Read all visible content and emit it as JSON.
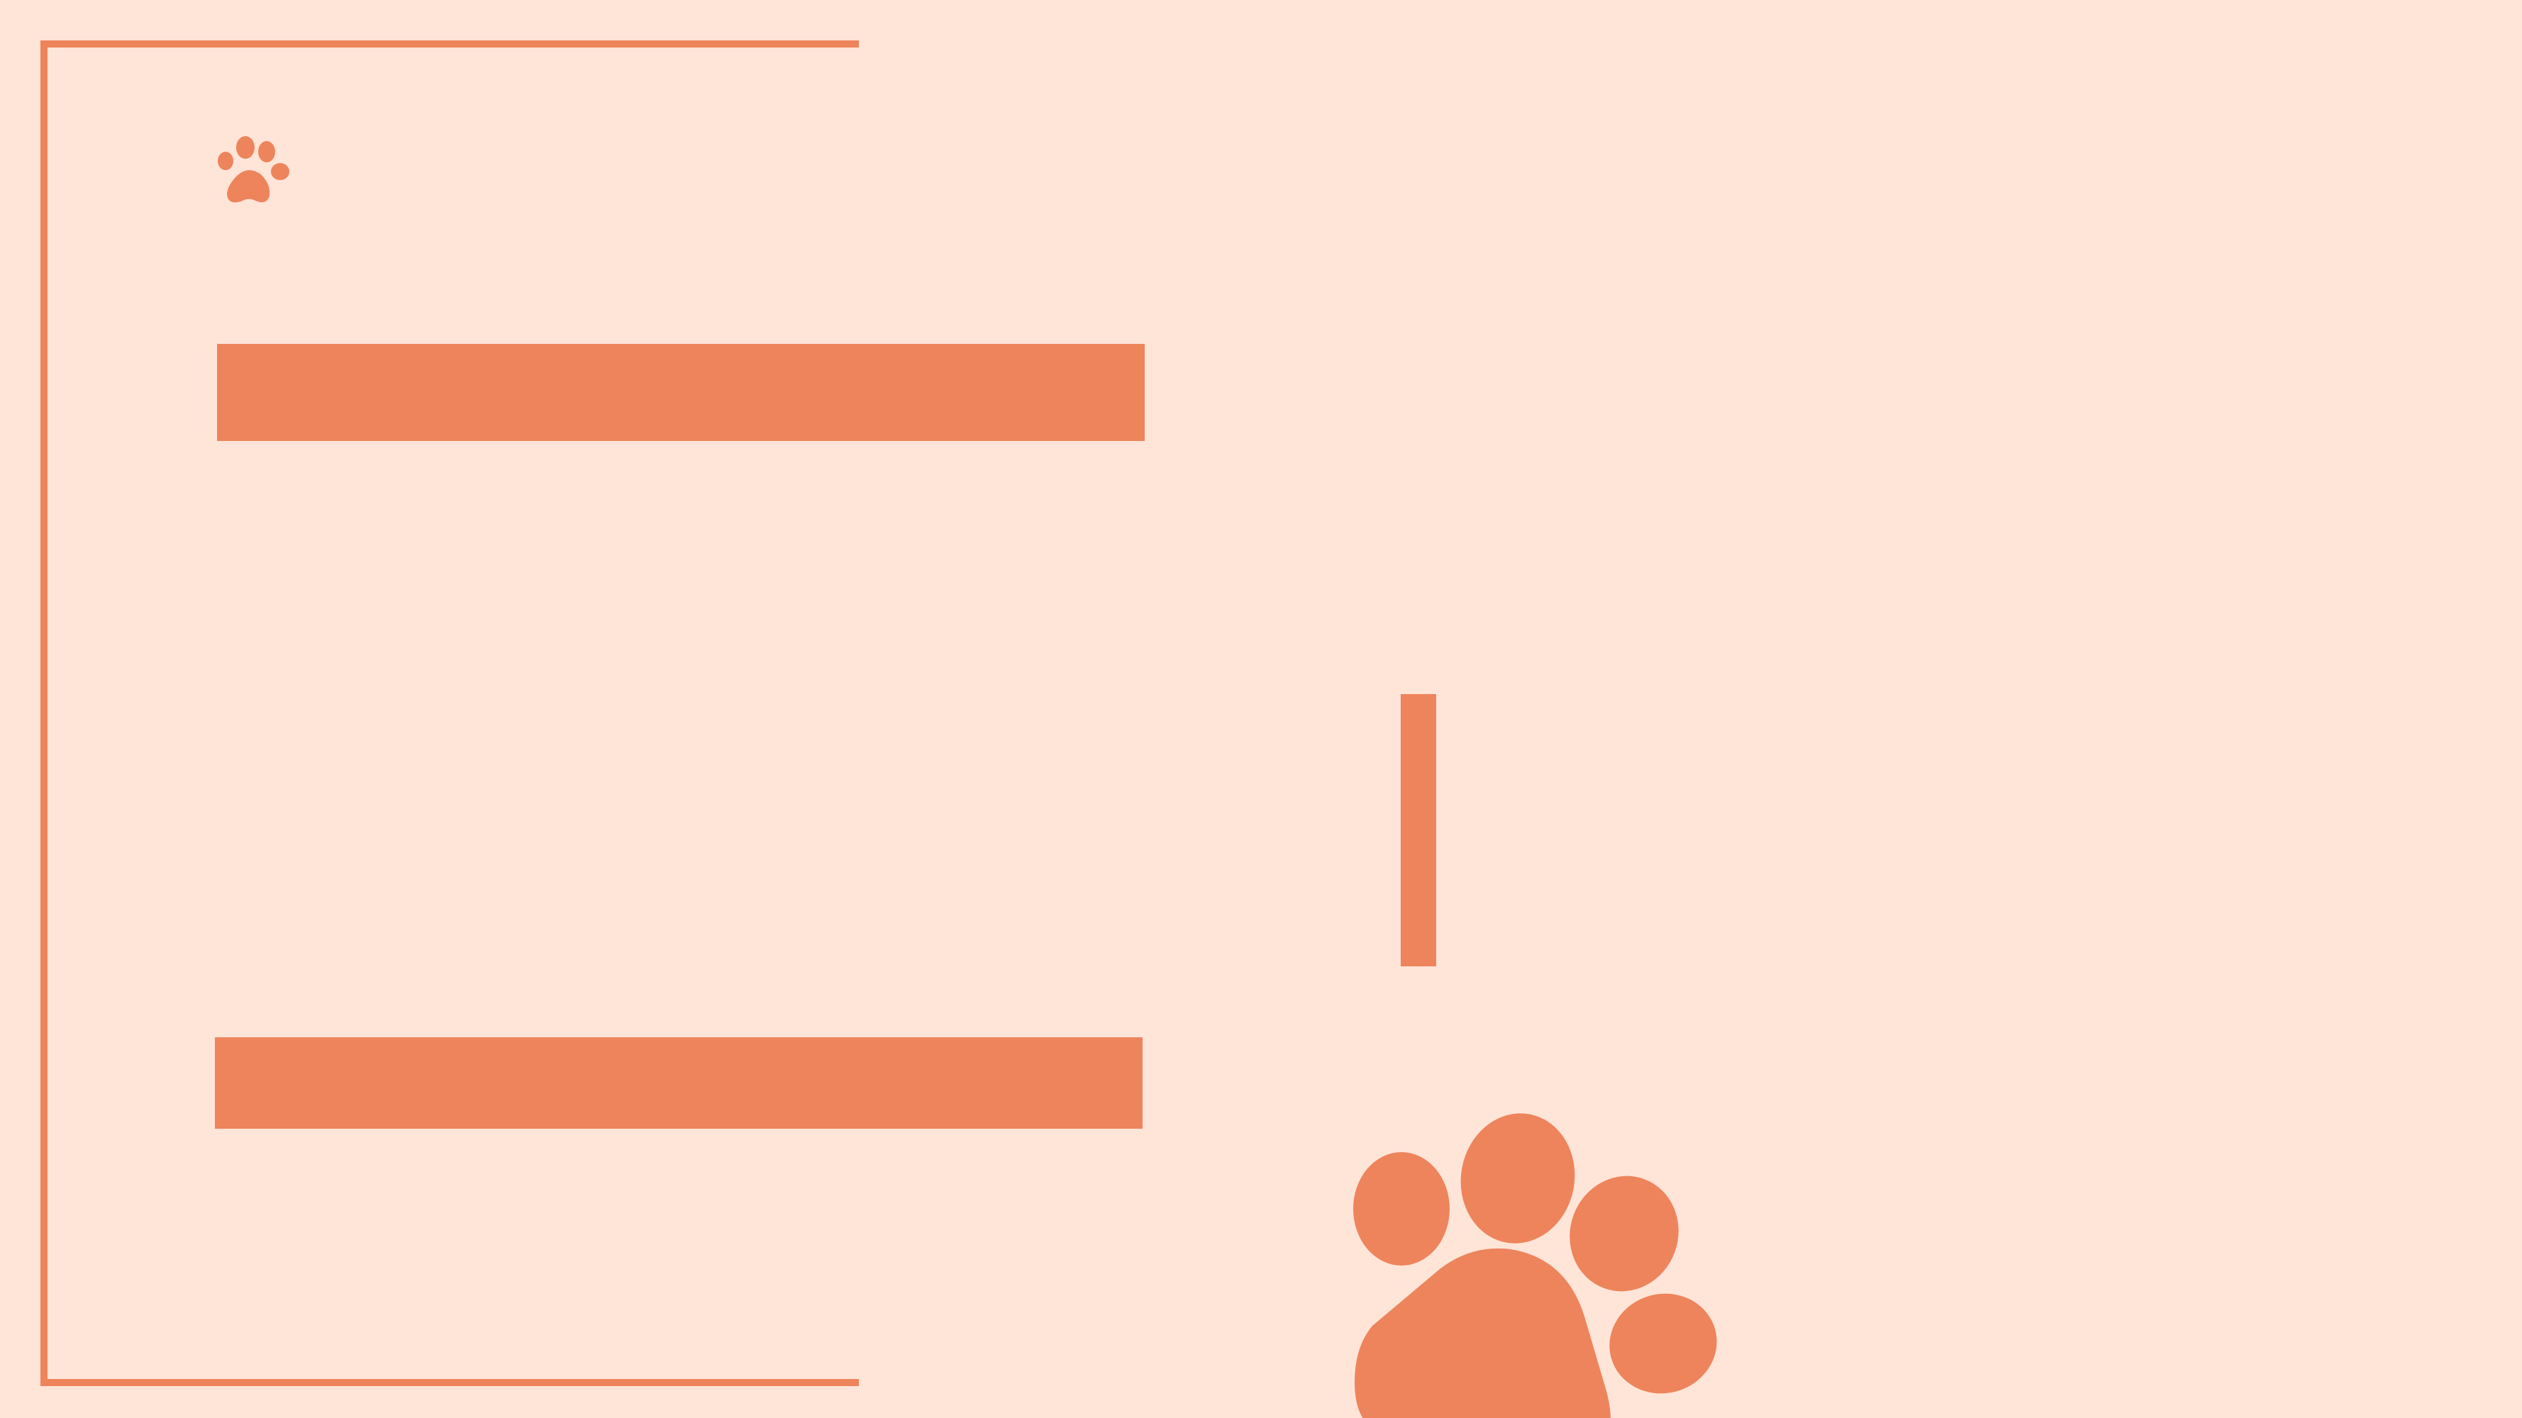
{
  "colors": {
    "background": "#FFE4D8",
    "accent": "#EE845B"
  },
  "logo": {
    "icon": "paw-print-icon",
    "text": ""
  },
  "decor": {
    "large_icon": "paw-print-icon"
  }
}
